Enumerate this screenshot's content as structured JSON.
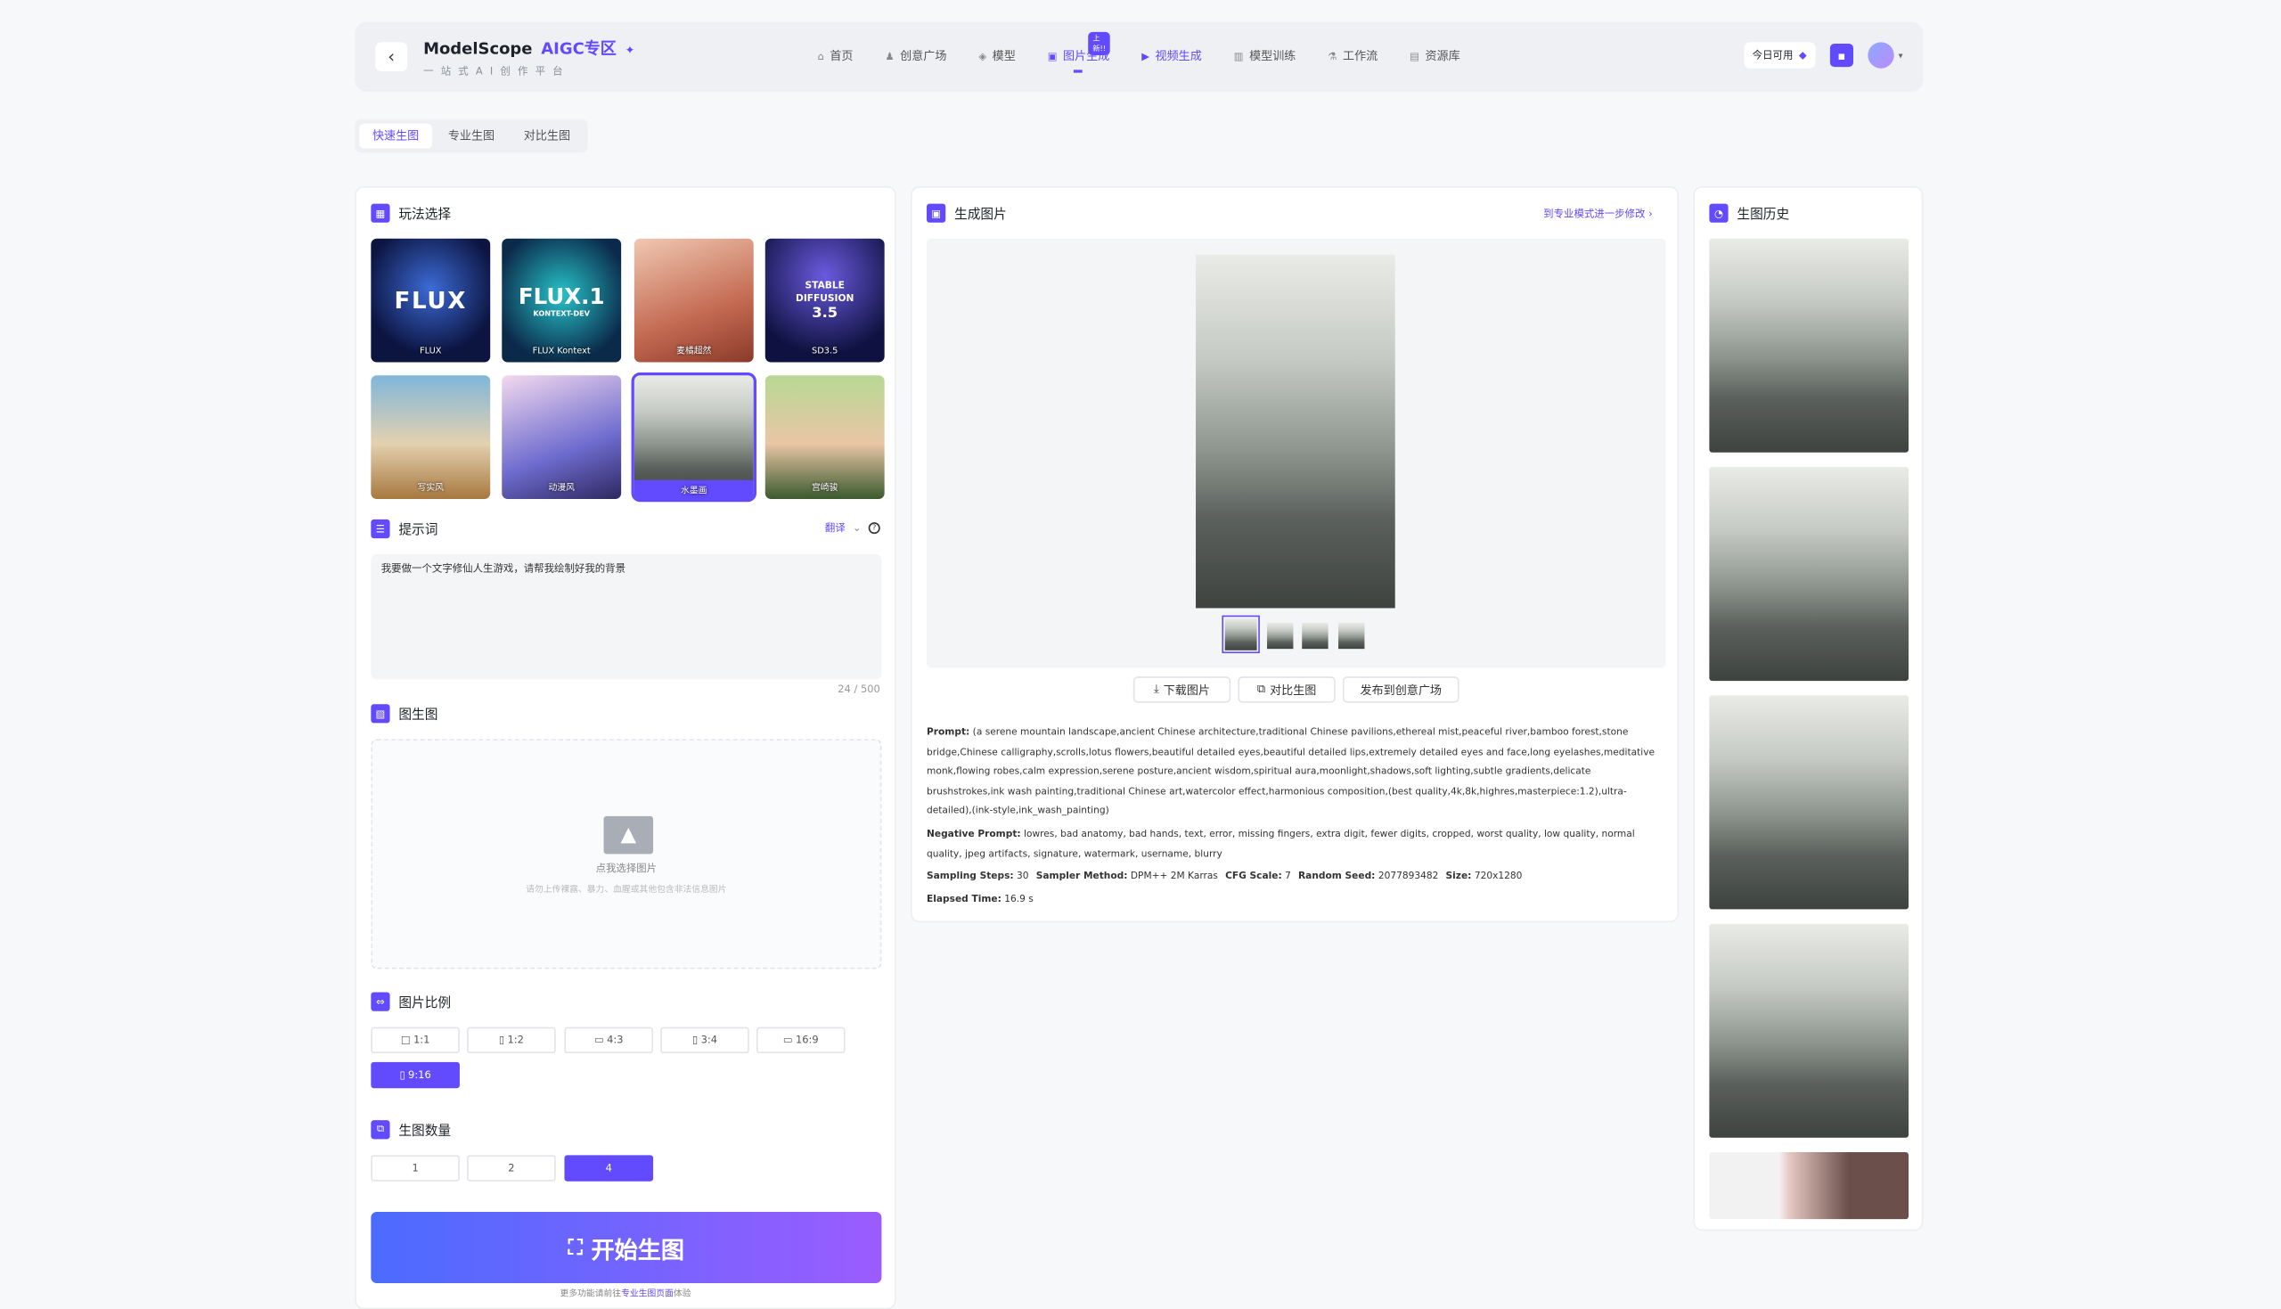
{
  "header": {
    "brand": "ModelScope",
    "brand_aigc": "AIGC专区",
    "brand_spark": "✦",
    "subtitle": "一站式AI创作平台",
    "back_icon": "‹",
    "nav": [
      {
        "label": "首页",
        "icon": "home-icon"
      },
      {
        "label": "创意广场",
        "icon": "user-icon"
      },
      {
        "label": "模型",
        "icon": "cube-icon"
      },
      {
        "label": "图片生成",
        "icon": "image-icon",
        "active": true,
        "badge": "上新!!"
      },
      {
        "label": "视频生成",
        "icon": "video-icon"
      },
      {
        "label": "模型训练",
        "icon": "chart-icon"
      },
      {
        "label": "工作流",
        "icon": "flow-icon"
      },
      {
        "label": "资源库",
        "icon": "database-icon"
      }
    ],
    "quota_label": "今日可用",
    "accent": "#624aff"
  },
  "tabs": [
    "快速生图",
    "专业生图",
    "对比生图"
  ],
  "left": {
    "style_title": "玩法选择",
    "styles": [
      {
        "label": "FLUX",
        "logo": "FLUX"
      },
      {
        "label": "FLUX Kontext",
        "logo": "FLUX.1",
        "logo_sub": "KONTEXT-DEV"
      },
      {
        "label": "麦橘超然"
      },
      {
        "label": "SD3.5",
        "logo": "STABLE DIFFUSION",
        "logo_sub": "3.5"
      },
      {
        "label": "写实风"
      },
      {
        "label": "动漫风"
      },
      {
        "label": "水墨画",
        "selected": true
      },
      {
        "label": "宫崎骏"
      }
    ],
    "prompt_title": "提示词",
    "translate": "翻译",
    "prompt_text": "我要做一个文字修仙人生游戏，请帮我绘制好我的背景",
    "prompt_count": "24 / 500",
    "img2img_title": "图生图",
    "upload_text": "点我选择图片",
    "upload_hint": "请勿上传裸露、暴力、血腥或其他包含非法信息图片",
    "ratio_title": "图片比例",
    "ratios": [
      "1:1",
      "1:2",
      "4:3",
      "3:4",
      "16:9",
      "9:16"
    ],
    "count_title": "生图数量",
    "counts": [
      "1",
      "2",
      "4"
    ],
    "generate": "开始生图",
    "footer_pre": "更多功能请前往",
    "footer_link": "专业生图页面",
    "footer_post": "体验"
  },
  "center": {
    "title": "生成图片",
    "pro_link": "到专业模式进一步修改",
    "download": "下载图片",
    "compare": "对比生图",
    "publish": "发布到创意广场",
    "prompt_label": "Prompt:",
    "prompt": "(a serene mountain landscape,ancient Chinese architecture,traditional Chinese pavilions,ethereal mist,peaceful river,bamboo forest,stone bridge,Chinese calligraphy,scrolls,lotus flowers,beautiful detailed eyes,beautiful detailed lips,extremely detailed eyes and face,long eyelashes,meditative monk,flowing robes,calm expression,serene posture,ancient wisdom,spiritual aura,moonlight,shadows,soft lighting,subtle gradients,delicate brushstrokes,ink wash painting,traditional Chinese art,watercolor effect,harmonious composition,(best quality,4k,8k,highres,masterpiece:1.2),ultra-detailed),(ink-style,ink_wash_painting)",
    "neg_label": "Negative Prompt:",
    "neg": "lowres, bad anatomy, bad hands, text, error, missing fingers, extra digit, fewer digits, cropped, worst quality, low quality, normal quality, jpeg artifacts, signature, watermark, username, blurry",
    "steps_label": "Sampling Steps:",
    "steps": "30",
    "method_label": "Sampler Method:",
    "method": "DPM++ 2M Karras",
    "cfg_label": "CFG Scale:",
    "cfg": "7",
    "seed_label": "Random Seed:",
    "seed": "2077893482",
    "size_label": "Size:",
    "size": "720x1280",
    "elapsed_label": "Elapsed Time:",
    "elapsed": "16.9 s"
  },
  "right": {
    "title": "生图历史"
  }
}
